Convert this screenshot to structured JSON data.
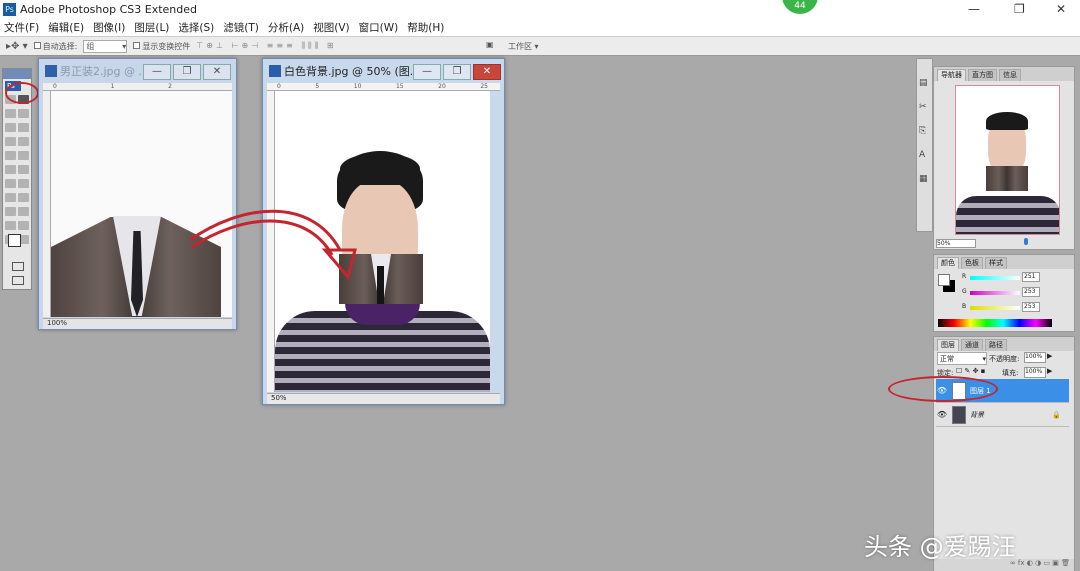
{
  "app": {
    "title": "Adobe Photoshop CS3 Extended",
    "logo": "Ps"
  },
  "window_controls": {
    "minimize": "—",
    "restore": "❐",
    "close": "✕"
  },
  "menu": [
    "文件(F)",
    "编辑(E)",
    "图像(I)",
    "图层(L)",
    "选择(S)",
    "滤镜(T)",
    "分析(A)",
    "视图(V)",
    "窗口(W)",
    "帮助(H)"
  ],
  "options": {
    "auto_select_label": "自动选择:",
    "auto_select_value": "组",
    "show_transform_label": "显示变换控件",
    "workspace_label": "工作区 ▾"
  },
  "toolbox": {
    "logo": "Ps"
  },
  "doc1": {
    "title": "男正装2.jpg @ ...",
    "zoom": "100%",
    "ruler": [
      "0",
      "1",
      "2"
    ]
  },
  "doc2": {
    "title": "白色背景.jpg @ 50% (图...",
    "zoom": "50%",
    "ruler": [
      "0",
      "5",
      "10",
      "15",
      "20",
      "25"
    ]
  },
  "navigator": {
    "tabs": [
      "导航器",
      "直方图",
      "信息"
    ],
    "zoom": "50%"
  },
  "color": {
    "tabs": [
      "颜色",
      "色板",
      "样式"
    ],
    "r": "251",
    "g": "253",
    "b": "253",
    "r_label": "R",
    "g_label": "G",
    "b_label": "B"
  },
  "layers": {
    "tabs": [
      "图层",
      "通道",
      "路径"
    ],
    "blend": "正常",
    "opacity_label": "不透明度:",
    "opacity": "100%",
    "lock_label": "锁定:",
    "fill_label": "填充:",
    "fill": "100%",
    "items": [
      {
        "name": "图层 1",
        "selected": true
      },
      {
        "name": "背景",
        "selected": false
      }
    ]
  },
  "badge": "44",
  "watermark": "头条 @爱踢汪"
}
